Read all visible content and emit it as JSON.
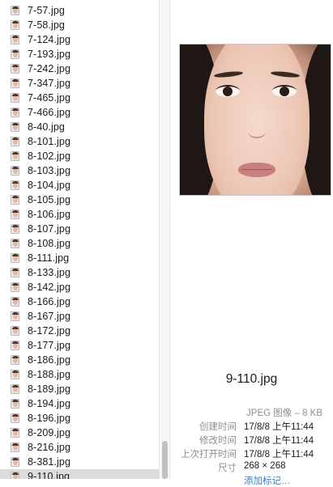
{
  "files": [
    "7-57.jpg",
    "7-58.jpg",
    "7-124.jpg",
    "7-193.jpg",
    "7-242.jpg",
    "7-347.jpg",
    "7-465.jpg",
    "7-466.jpg",
    "8-40.jpg",
    "8-101.jpg",
    "8-102.jpg",
    "8-103.jpg",
    "8-104.jpg",
    "8-105.jpg",
    "8-106.jpg",
    "8-107.jpg",
    "8-108.jpg",
    "8-111.jpg",
    "8-133.jpg",
    "8-142.jpg",
    "8-166.jpg",
    "8-167.jpg",
    "8-172.jpg",
    "8-177.jpg",
    "8-186.jpg",
    "8-188.jpg",
    "8-189.jpg",
    "8-194.jpg",
    "8-196.jpg",
    "8-209.jpg",
    "8-216.jpg",
    "8-381.jpg",
    "9-110.jpg"
  ],
  "selected_file": "9-110.jpg",
  "preview": {
    "filename": "9-110.jpg",
    "kind": "JPEG 图像 – 8 KB",
    "metadata": [
      {
        "key": "创建时间",
        "value": "17/8/8 上午11:44"
      },
      {
        "key": "修改时间",
        "value": "17/8/8 上午11:44"
      },
      {
        "key": "上次打开时间",
        "value": "17/8/8 上午11:44"
      },
      {
        "key": "尺寸",
        "value": "268 × 268"
      }
    ],
    "add_tags": "添加标记…"
  },
  "colors": {
    "selected_row": "#dcdcdc",
    "link": "#3a7fd5",
    "label_gray": "#8e8e8e"
  },
  "icons": {
    "file_thumb": "image-thumbnail-icon"
  }
}
